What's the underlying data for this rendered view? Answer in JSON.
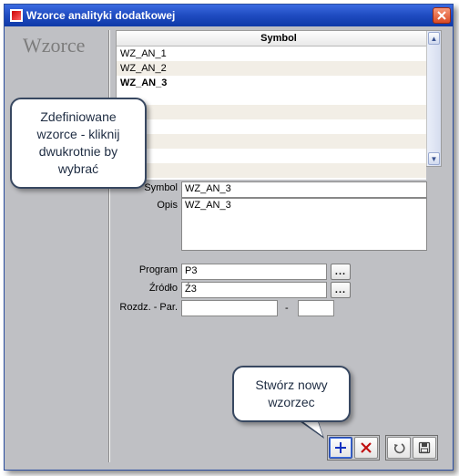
{
  "window": {
    "title": "Wzorce analityki dodatkowej"
  },
  "sidebar": {
    "heading": "Wzorce"
  },
  "list": {
    "header": "Symbol",
    "rows": [
      "WZ_AN_1",
      "WZ_AN_2",
      "WZ_AN_3"
    ]
  },
  "callouts": {
    "patterns": "Zdefiniowane wzorce - kliknij dwukrotnie by wybrać",
    "create": "Stwórz nowy wzorzec"
  },
  "details": {
    "symbol_label": "Symbol",
    "symbol_value": "WZ_AN_3",
    "opis_label": "Opis",
    "opis_value": "WZ_AN_3",
    "program_label": "Program",
    "program_value": "P3",
    "zrodlo_label": "Źródło",
    "zrodlo_value": "Ź3",
    "rozdz_label": "Rozdz. - Par.",
    "rozdz_value": "",
    "par_value": "",
    "dash": "-",
    "browse": "..."
  },
  "scroll": {
    "up": "▲",
    "down": "▼"
  }
}
